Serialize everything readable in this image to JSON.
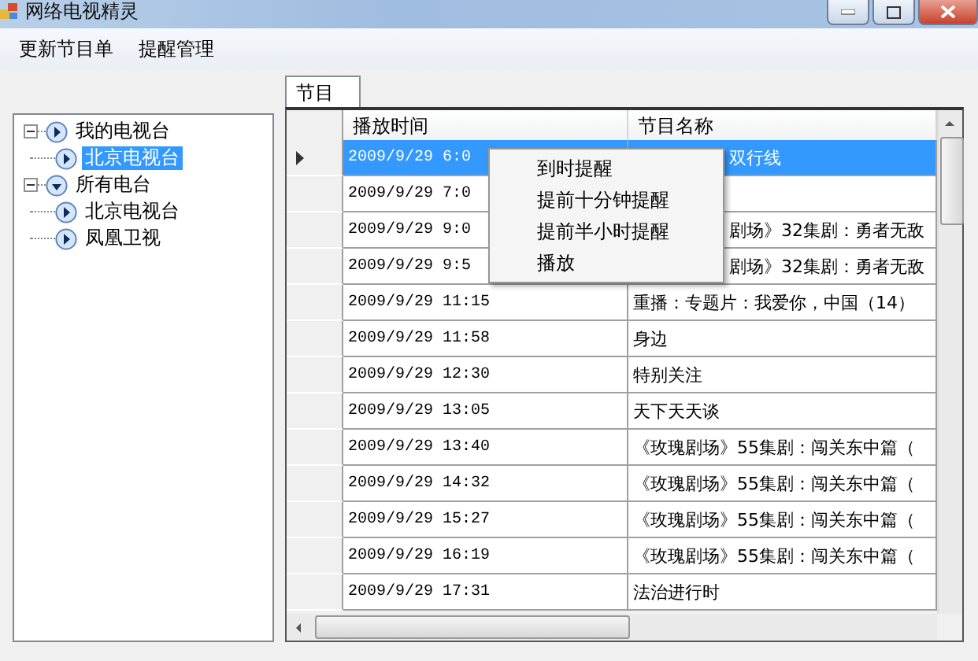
{
  "window": {
    "title": "网络电视精灵"
  },
  "menu": [
    {
      "label": "更新节目单"
    },
    {
      "label": "提醒管理"
    }
  ],
  "tree": [
    {
      "label": "我的电视台",
      "kind": "play",
      "expanded": true,
      "selected": false,
      "children": [
        {
          "label": "北京电视台",
          "kind": "play",
          "selected": true
        }
      ]
    },
    {
      "label": "所有电台",
      "kind": "down",
      "expanded": true,
      "selected": false,
      "children": [
        {
          "label": "北京电视台",
          "kind": "play",
          "selected": false
        },
        {
          "label": "凤凰卫视",
          "kind": "play",
          "selected": false
        }
      ]
    }
  ],
  "tabs": [
    {
      "label": "节目",
      "selected": true
    }
  ],
  "table": {
    "columns": [
      "播放时间",
      "节目名称"
    ],
    "rows": [
      {
        "time": "2009/9/29 6:0",
        "name": "双行线",
        "selected": true,
        "covered": true
      },
      {
        "time": "2009/9/29 7:0",
        "selected": false,
        "covered": true
      },
      {
        "time": "2009/9/29 9:0",
        "name": "剧场》32集剧：勇者无敌",
        "selected": false,
        "covered": true
      },
      {
        "time": "2009/9/29 9:5",
        "name": "剧场》32集剧：勇者无敌",
        "selected": false,
        "covered": true
      },
      {
        "time": "2009/9/29 11:15",
        "name": "重播：专题片：我爱你，中国（14）",
        "selected": false,
        "covered": false
      },
      {
        "time": "2009/9/29 11:58",
        "name": "身边",
        "selected": false,
        "covered": false
      },
      {
        "time": "2009/9/29 12:30",
        "name": "特别关注",
        "selected": false,
        "covered": false
      },
      {
        "time": "2009/9/29 13:05",
        "name": "天下天天谈",
        "selected": false,
        "covered": false
      },
      {
        "time": "2009/9/29 13:40",
        "name": "《玫瑰剧场》55集剧：闯关东中篇（",
        "selected": false,
        "covered": false
      },
      {
        "time": "2009/9/29 14:32",
        "name": "《玫瑰剧场》55集剧：闯关东中篇（",
        "selected": false,
        "covered": false
      },
      {
        "time": "2009/9/29 15:27",
        "name": "《玫瑰剧场》55集剧：闯关东中篇（",
        "selected": false,
        "covered": false
      },
      {
        "time": "2009/9/29 16:19",
        "name": "《玫瑰剧场》55集剧：闯关东中篇（",
        "selected": false,
        "covered": false
      },
      {
        "time": "2009/9/29 17:31",
        "name": "法治进行时",
        "selected": false,
        "covered": false
      }
    ]
  },
  "context_menu": [
    {
      "label": "到时提醒"
    },
    {
      "label": "提前十分钟提醒"
    },
    {
      "label": "提前半小时提醒"
    },
    {
      "label": "播放"
    }
  ]
}
